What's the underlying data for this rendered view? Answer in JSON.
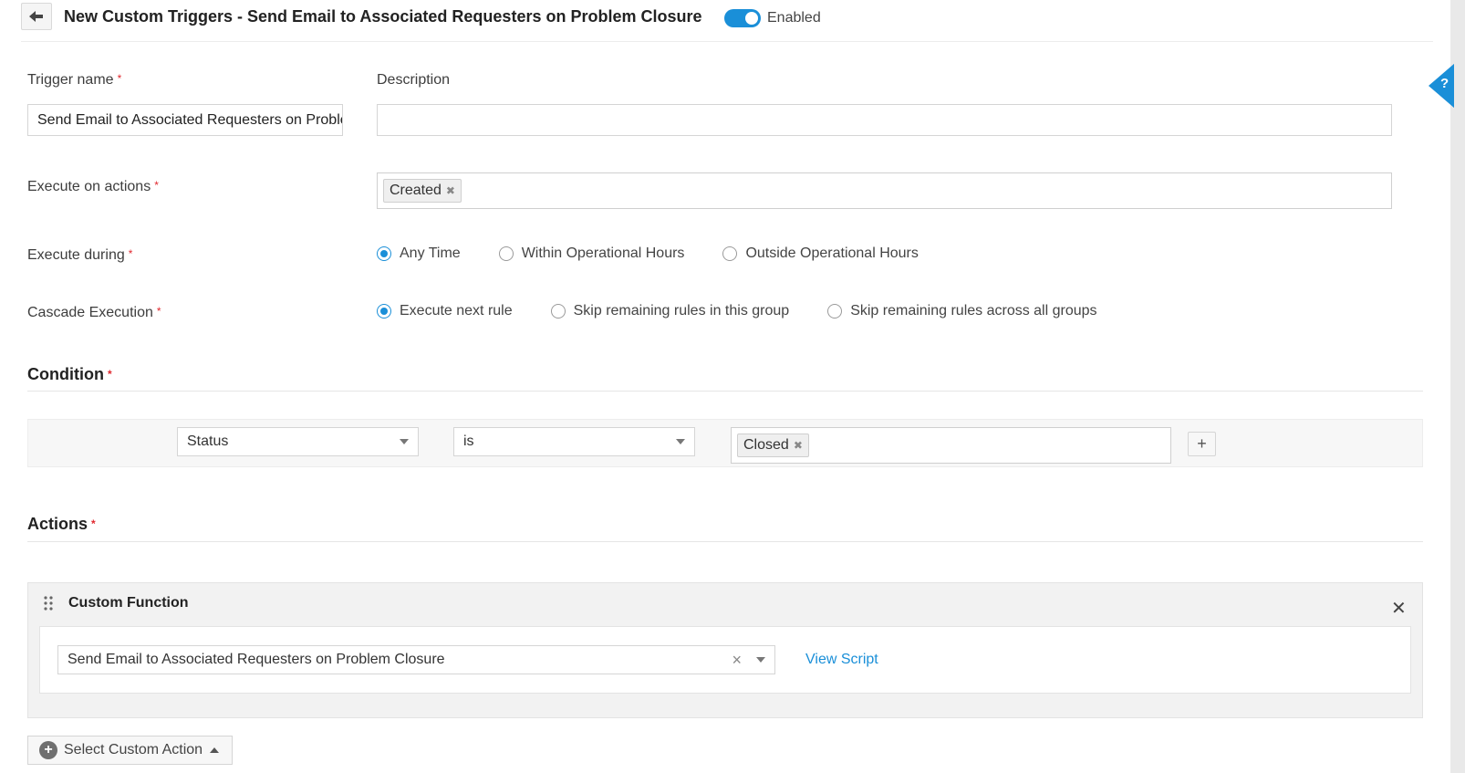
{
  "header": {
    "back_icon": "arrow-left-icon",
    "title": "New Custom Triggers - Send Email to Associated Requesters on Problem Closure",
    "toggle_label": "Enabled",
    "toggle_on": true,
    "accent_color": "#1a8fd8"
  },
  "help": {
    "label": "?",
    "icon": "help-icon"
  },
  "form": {
    "trigger_name_label": "Trigger name",
    "trigger_name_value": "Send Email to Associated Requesters on Problem Closure",
    "description_label": "Description",
    "description_value": "",
    "execute_actions_label": "Execute on actions",
    "execute_actions_chips": [
      "Created"
    ],
    "execute_during_label": "Execute during",
    "execute_during_options": [
      "Any Time",
      "Within Operational Hours",
      "Outside Operational Hours"
    ],
    "execute_during_selected": "Any Time",
    "cascade_label": "Cascade Execution",
    "cascade_options": [
      "Execute next rule",
      "Skip remaining rules in this group",
      "Skip remaining rules across all groups"
    ],
    "cascade_selected": "Execute next rule",
    "required_mark": "*"
  },
  "condition": {
    "title": "Condition",
    "field": "Status",
    "operator": "is",
    "values": [
      "Closed"
    ],
    "add_label": "+"
  },
  "actions": {
    "title": "Actions",
    "card_title": "Custom Function",
    "function_value": "Send Email to Associated Requesters on Problem Closure",
    "view_script": "View Script",
    "clear_label": "×",
    "close_label": "✕",
    "select_action_label": "Select Custom Action"
  }
}
